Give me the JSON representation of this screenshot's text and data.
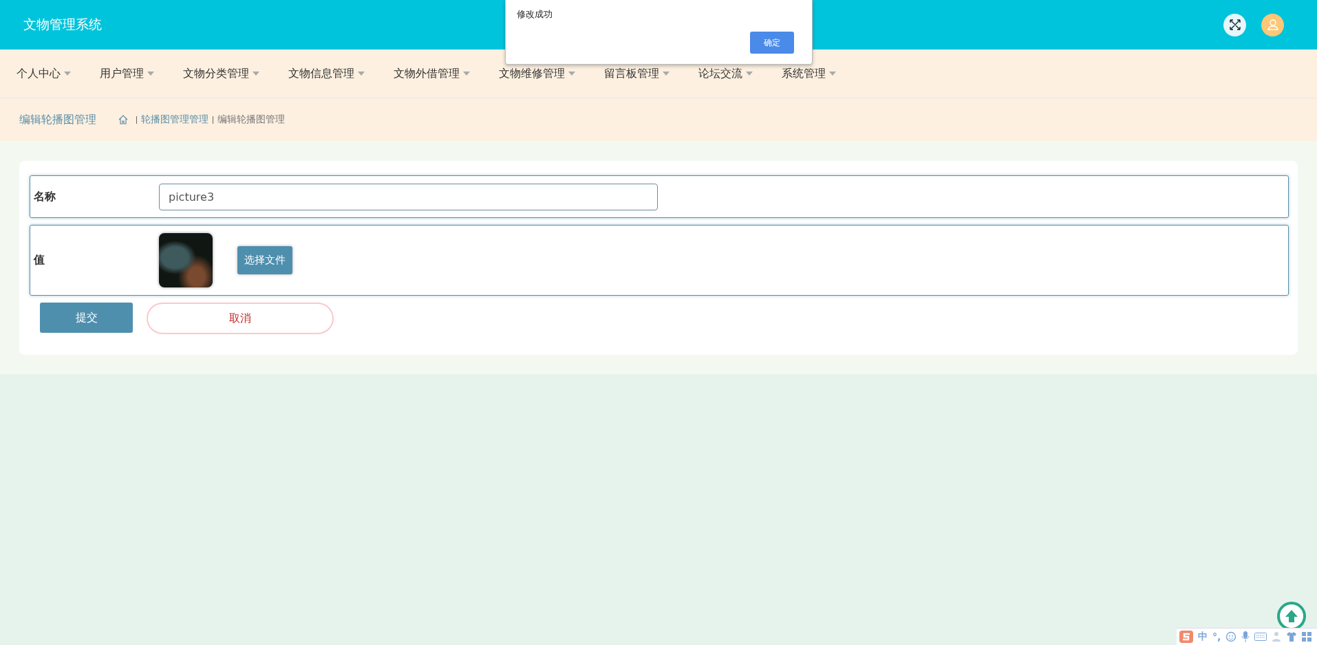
{
  "header": {
    "title": "文物管理系统"
  },
  "alert": {
    "message": "修改成功",
    "button": "确定"
  },
  "nav": [
    {
      "label": "个人中心"
    },
    {
      "label": "用户管理"
    },
    {
      "label": "文物分类管理"
    },
    {
      "label": "文物信息管理"
    },
    {
      "label": "文物外借管理"
    },
    {
      "label": "文物维修管理"
    },
    {
      "label": "留言板管理"
    },
    {
      "label": "论坛交流"
    },
    {
      "label": "系统管理"
    }
  ],
  "page_title": "编辑轮播图管理",
  "breadcrumb": [
    "轮播图管理管理",
    "编辑轮播图管理"
  ],
  "form": {
    "fields": [
      {
        "kind": "text",
        "label": "名称",
        "value": "picture3"
      },
      {
        "kind": "image",
        "label": "值",
        "button": "选择文件"
      }
    ],
    "submit": "提交",
    "cancel": "取消"
  },
  "ime_bar": {
    "mode": "中",
    "punct": "°,"
  }
}
